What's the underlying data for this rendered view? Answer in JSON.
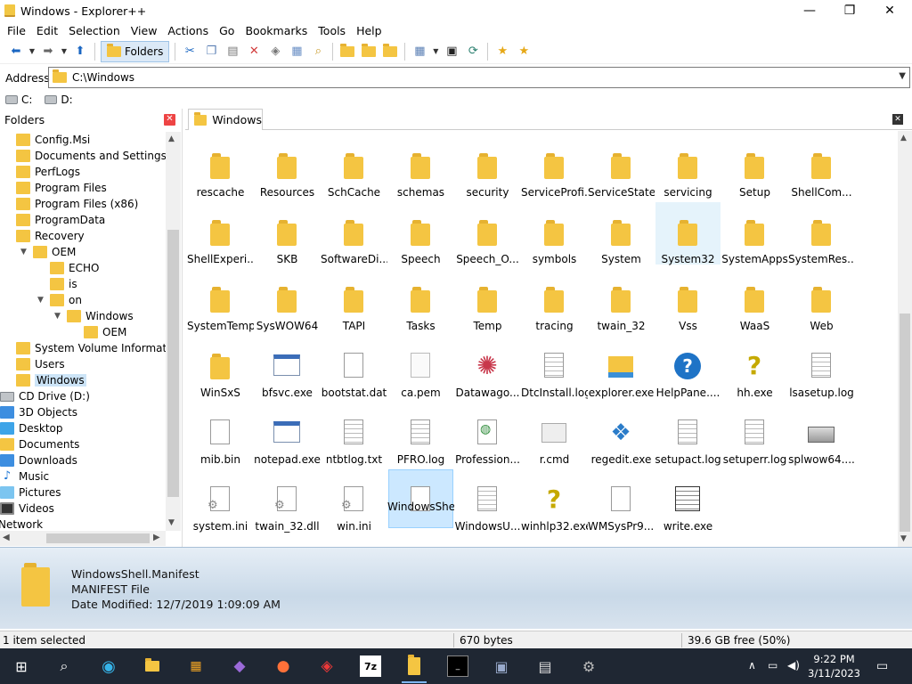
{
  "window": {
    "title": "Windows - Explorer++",
    "min": "—",
    "max": "❐",
    "close": "✕"
  },
  "menu": [
    "File",
    "Edit",
    "Selection",
    "View",
    "Actions",
    "Go",
    "Bookmarks",
    "Tools",
    "Help"
  ],
  "toolbar": {
    "folders_label": "Folders"
  },
  "address": {
    "label": "Address",
    "path": "C:\\Windows"
  },
  "drives": [
    "C:",
    "D:"
  ],
  "folders_panel": {
    "title": "Folders",
    "items": [
      {
        "label": "Config.Msi",
        "level": 1,
        "icon": "folder"
      },
      {
        "label": "Documents and Settings",
        "level": 1,
        "icon": "folder"
      },
      {
        "label": "PerfLogs",
        "level": 1,
        "icon": "folder"
      },
      {
        "label": "Program Files",
        "level": 1,
        "icon": "folder"
      },
      {
        "label": "Program Files (x86)",
        "level": 1,
        "icon": "folder"
      },
      {
        "label": "ProgramData",
        "level": 1,
        "icon": "folder"
      },
      {
        "label": "Recovery",
        "level": 1,
        "icon": "folder"
      },
      {
        "label": "OEM",
        "level": 2,
        "icon": "folder"
      },
      {
        "label": "ECHO",
        "level": 3,
        "icon": "folder"
      },
      {
        "label": "is",
        "level": 3,
        "icon": "folder"
      },
      {
        "label": "on",
        "level": 3,
        "icon": "folder"
      },
      {
        "label": "Windows",
        "level": 4,
        "icon": "folder"
      },
      {
        "label": "OEM",
        "level": 5,
        "icon": "folder"
      },
      {
        "label": "System Volume Information",
        "level": 1,
        "icon": "folder"
      },
      {
        "label": "Users",
        "level": 1,
        "icon": "folder"
      },
      {
        "label": "Windows",
        "level": 1,
        "icon": "folder",
        "selected": true
      },
      {
        "label": "CD Drive (D:)",
        "level": 0,
        "icon": "drive"
      },
      {
        "label": "3D Objects",
        "level": 0,
        "icon": "blue"
      },
      {
        "label": "Desktop",
        "level": 0,
        "icon": "desk"
      },
      {
        "label": "Documents",
        "level": 0,
        "icon": "doc"
      },
      {
        "label": "Downloads",
        "level": 0,
        "icon": "blue"
      },
      {
        "label": "Music",
        "level": 0,
        "icon": "music"
      },
      {
        "label": "Pictures",
        "level": 0,
        "icon": "pic"
      },
      {
        "label": "Videos",
        "level": 0,
        "icon": "vid"
      },
      {
        "label": "Network",
        "level": -1,
        "icon": "net"
      }
    ]
  },
  "tab": {
    "label": "Windows"
  },
  "files": [
    {
      "name": "rescache",
      "icon": "folder"
    },
    {
      "name": "Resources",
      "icon": "folder"
    },
    {
      "name": "SchCache",
      "icon": "folder"
    },
    {
      "name": "schemas",
      "icon": "folder"
    },
    {
      "name": "security",
      "icon": "folder"
    },
    {
      "name": "ServiceProfi...",
      "icon": "folder"
    },
    {
      "name": "ServiceState",
      "icon": "folder"
    },
    {
      "name": "servicing",
      "icon": "folder"
    },
    {
      "name": "Setup",
      "icon": "folder"
    },
    {
      "name": "ShellCom...",
      "icon": "folder"
    },
    {
      "name": "ShellExperi...",
      "icon": "folder"
    },
    {
      "name": "SKB",
      "icon": "folder"
    },
    {
      "name": "SoftwareDi...",
      "icon": "folder"
    },
    {
      "name": "Speech",
      "icon": "folder"
    },
    {
      "name": "Speech_O...",
      "icon": "folder"
    },
    {
      "name": "symbols",
      "icon": "folder"
    },
    {
      "name": "System",
      "icon": "folder"
    },
    {
      "name": "System32",
      "icon": "folder",
      "hover": true
    },
    {
      "name": "SystemApps",
      "icon": "folder"
    },
    {
      "name": "SystemRes...",
      "icon": "folder"
    },
    {
      "name": "SystemTemp",
      "icon": "folder"
    },
    {
      "name": "SysWOW64",
      "icon": "folder"
    },
    {
      "name": "TAPI",
      "icon": "folder"
    },
    {
      "name": "Tasks",
      "icon": "folder"
    },
    {
      "name": "Temp",
      "icon": "folder"
    },
    {
      "name": "tracing",
      "icon": "folder"
    },
    {
      "name": "twain_32",
      "icon": "folder"
    },
    {
      "name": "Vss",
      "icon": "folder"
    },
    {
      "name": "WaaS",
      "icon": "folder"
    },
    {
      "name": "Web",
      "icon": "folder"
    },
    {
      "name": "WinSxS",
      "icon": "folder"
    },
    {
      "name": "bfsvc.exe",
      "icon": "exe"
    },
    {
      "name": "bootstat.dat",
      "icon": "doc"
    },
    {
      "name": "ca.pem",
      "icon": "pem"
    },
    {
      "name": "Datawago...",
      "icon": "snow"
    },
    {
      "name": "DtcInstall.log",
      "icon": "txt"
    },
    {
      "name": "explorer.exe",
      "icon": "explorer"
    },
    {
      "name": "HelpPane....",
      "icon": "help"
    },
    {
      "name": "hh.exe",
      "icon": "help2"
    },
    {
      "name": "lsasetup.log",
      "icon": "txt"
    },
    {
      "name": "mib.bin",
      "icon": "doc"
    },
    {
      "name": "notepad.exe",
      "icon": "exe"
    },
    {
      "name": "ntbtlog.txt",
      "icon": "txt"
    },
    {
      "name": "PFRO.log",
      "icon": "txt"
    },
    {
      "name": "Profession...",
      "icon": "web"
    },
    {
      "name": "r.cmd",
      "icon": "cmd"
    },
    {
      "name": "regedit.exe",
      "icon": "cube"
    },
    {
      "name": "setupact.log",
      "icon": "txt"
    },
    {
      "name": "setuperr.log",
      "icon": "txt"
    },
    {
      "name": "splwow64....",
      "icon": "printer"
    },
    {
      "name": "system.ini",
      "icon": "gear"
    },
    {
      "name": "twain_32.dll",
      "icon": "gear"
    },
    {
      "name": "win.ini",
      "icon": "gear"
    },
    {
      "name": "WindowsShell.Manifest",
      "icon": "doc",
      "selected": true
    },
    {
      "name": "WindowsU...",
      "icon": "txt"
    },
    {
      "name": "winhlp32.exe",
      "icon": "help2"
    },
    {
      "name": "WMSysPr9....",
      "icon": "doc"
    },
    {
      "name": "write.exe",
      "icon": "write"
    }
  ],
  "info": {
    "name": "WindowsShell.Manifest",
    "type": "MANIFEST File",
    "modified": "Date Modified: 12/7/2019 1:09:09 AM"
  },
  "status": {
    "selected": "1 item selected",
    "size": "670 bytes",
    "free": "39.6 GB free (50%)"
  },
  "taskbar": {
    "time": "9:22 PM",
    "date": "3/11/2023",
    "icons": [
      "start-icon",
      "search-icon",
      "edge-icon",
      "file-explorer-icon",
      "store-icon",
      "visual-studio-icon",
      "firefox-icon",
      "vivaldi-icon",
      "7zip-icon",
      "explorerpp-icon",
      "terminal-icon",
      "task-manager-icon",
      "notepad-icon",
      "tools-icon"
    ]
  }
}
